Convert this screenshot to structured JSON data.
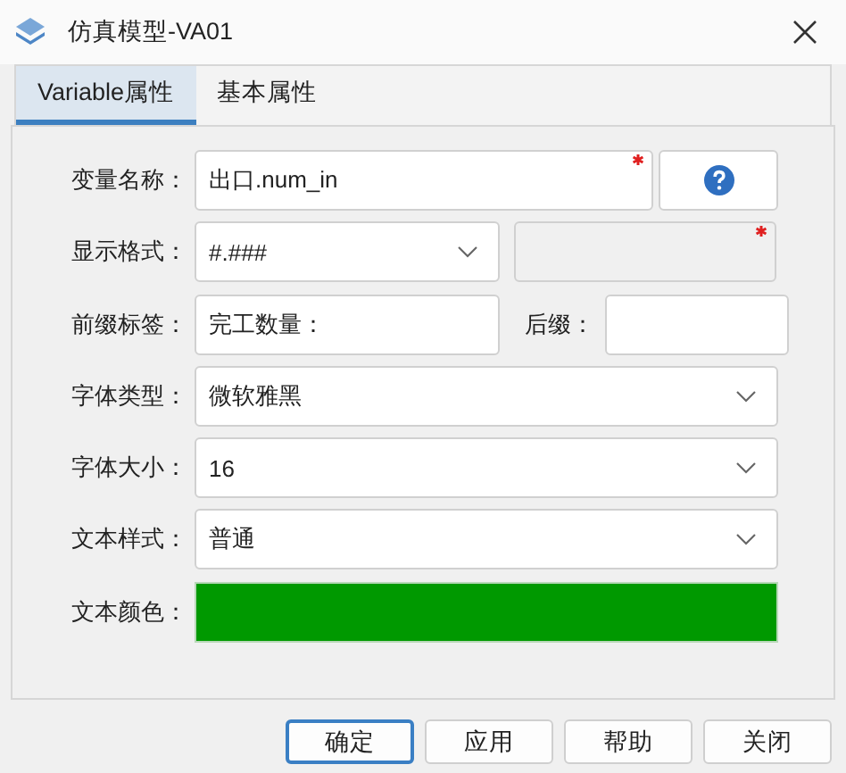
{
  "window": {
    "title": "仿真模型-VA01"
  },
  "tabs": [
    {
      "label": "Variable属性",
      "selected": true
    },
    {
      "label": "基本属性",
      "selected": false
    }
  ],
  "form": [
    {
      "kind": "text",
      "label": "变量名称：",
      "value": "出口.num_in",
      "required": true,
      "help_button": true
    },
    {
      "kind": "combo",
      "label": "显示格式：",
      "value": "#.###",
      "extra_field": {
        "disabled": true,
        "required": true
      }
    },
    {
      "kind": "text",
      "label": "前缀标签：",
      "value": "完工数量：",
      "suffix": {
        "label": "后缀："
      }
    },
    {
      "kind": "combo",
      "label": "字体类型：",
      "value": "微软雅黑"
    },
    {
      "kind": "combo",
      "label": "字体大小：",
      "value": "16"
    },
    {
      "kind": "combo",
      "label": "文本样式：",
      "value": "普通"
    },
    {
      "kind": "color",
      "label": "文本颜色：",
      "color": "#009900"
    }
  ],
  "buttons": [
    {
      "label": "确定",
      "default": true
    },
    {
      "label": "应用",
      "default": false
    },
    {
      "label": "帮助",
      "default": false
    },
    {
      "label": "关闭",
      "default": false
    }
  ]
}
